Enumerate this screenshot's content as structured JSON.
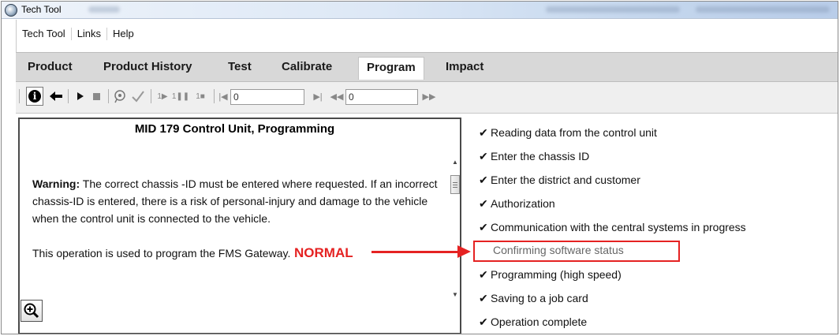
{
  "window": {
    "title": "Tech Tool"
  },
  "menu": {
    "items": [
      "Tech Tool",
      "Links",
      "Help"
    ]
  },
  "tabs": [
    {
      "label": "Product",
      "active": false
    },
    {
      "label": "Product History",
      "active": false
    },
    {
      "label": "Test",
      "active": false
    },
    {
      "label": "Calibrate",
      "active": false
    },
    {
      "label": "Program",
      "active": true
    },
    {
      "label": "Impact",
      "active": false
    }
  ],
  "toolbar": {
    "input1_value": "0",
    "input2_value": "0",
    "icons": [
      "info-icon",
      "back-arrow-icon",
      "play-icon",
      "stop-icon",
      "observe-icon",
      "check-icon",
      "step-play-icon",
      "step-pause-icon",
      "step-stop-icon",
      "first-icon",
      "last-icon",
      "rewind-icon",
      "fast-forward-icon"
    ]
  },
  "panel": {
    "title": "MID 179 Control Unit, Programming",
    "warning_label": "Warning:",
    "warning_text": " The correct chassis -ID must be entered where requested. If an incorrect chassis-ID is entered, there is a risk of personal-injury and damage to the vehicle when the control unit is connected to the vehicle.",
    "info_text": "This operation is used to program the FMS Gateway."
  },
  "steps": [
    {
      "label": "Reading data from the control unit",
      "done": true
    },
    {
      "label": "Enter the chassis ID",
      "done": true
    },
    {
      "label": "Enter the district and customer",
      "done": true
    },
    {
      "label": "Authorization",
      "done": true
    },
    {
      "label": "Communication with the central systems in progress",
      "done": true
    },
    {
      "label": "Confirming software status",
      "done": false
    },
    {
      "label": "Programming  (high speed)",
      "done": true
    },
    {
      "label": "Saving to a job card",
      "done": true
    },
    {
      "label": "Operation complete",
      "done": true
    }
  ],
  "annotation": {
    "label": "NORMAL",
    "color": "#e52222"
  }
}
